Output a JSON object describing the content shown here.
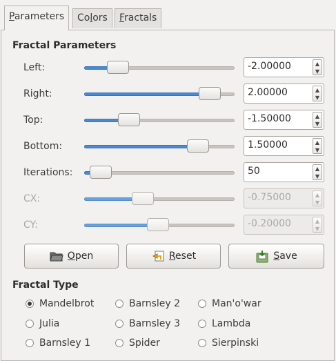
{
  "tabs": [
    {
      "label_pre": "",
      "label_ul": "P",
      "label_post": "arameters",
      "active": true
    },
    {
      "label_pre": "Co",
      "label_ul": "l",
      "label_post": "ors",
      "active": false
    },
    {
      "label_pre": "",
      "label_ul": "F",
      "label_post": "ractals",
      "active": false
    }
  ],
  "params": {
    "title": "Fractal Parameters",
    "rows": [
      {
        "label": "Left:",
        "value": "-2.00000",
        "enabled": true
      },
      {
        "label": "Right:",
        "value": "2.00000",
        "enabled": true
      },
      {
        "label": "Top:",
        "value": "-1.50000",
        "enabled": true
      },
      {
        "label": "Bottom:",
        "value": "1.50000",
        "enabled": true
      },
      {
        "label": "Iterations:",
        "value": "50",
        "enabled": true
      },
      {
        "label": "CX:",
        "value": "-0.75000",
        "enabled": false
      },
      {
        "label": "CY:",
        "value": "-0.20000",
        "enabled": false
      }
    ]
  },
  "buttons": {
    "open": {
      "ul": "O",
      "rest": "pen"
    },
    "reset": {
      "ul": "R",
      "rest": "eset"
    },
    "save": {
      "ul": "S",
      "rest": "ave"
    }
  },
  "fractal_type": {
    "title": "Fractal Type",
    "options": [
      {
        "label": "Mandelbrot",
        "checked": true
      },
      {
        "label": "Barnsley 2",
        "checked": false
      },
      {
        "label": "Man'o'war",
        "checked": false
      },
      {
        "label": "Julia",
        "checked": false
      },
      {
        "label": "Barnsley 3",
        "checked": false
      },
      {
        "label": "Lambda",
        "checked": false
      },
      {
        "label": "Barnsley 1",
        "checked": false
      },
      {
        "label": "Spider",
        "checked": false
      },
      {
        "label": "Sierpinski",
        "checked": false
      }
    ]
  },
  "colors": {
    "accent": "#4a8ad4",
    "background": "#f2f1f0"
  }
}
